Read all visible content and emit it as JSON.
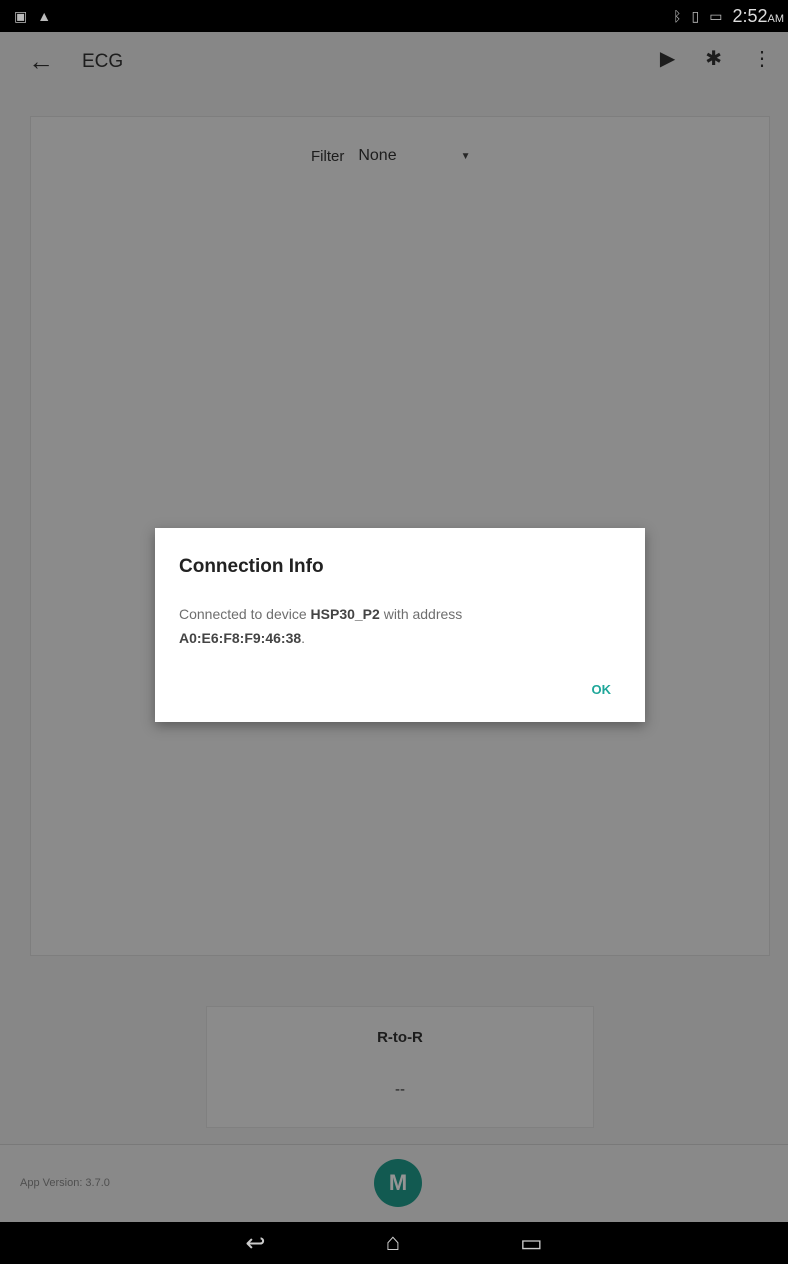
{
  "status_bar": {
    "left_icons": [
      "image-icon",
      "warning-icon"
    ],
    "right_icons": [
      "bluetooth-icon",
      "vibrate-icon",
      "battery-icon"
    ],
    "time": "2:52",
    "ampm": "AM"
  },
  "toolbar": {
    "title": "ECG"
  },
  "filter": {
    "label": "Filter",
    "value": "None"
  },
  "rr": {
    "title": "R-to-R",
    "value": "--"
  },
  "footer": {
    "app_version": "App Version: 3.7.0"
  },
  "dialog": {
    "title": "Connection Info",
    "msg_prefix": "Connected to device ",
    "device": "HSP30_P2",
    "msg_mid": " with address ",
    "address": "A0:E6:F8:F9:46:38",
    "msg_suffix": ".",
    "ok_label": "OK"
  },
  "colors": {
    "accent": "#1fa79a",
    "logo": "#1f9c8c"
  }
}
